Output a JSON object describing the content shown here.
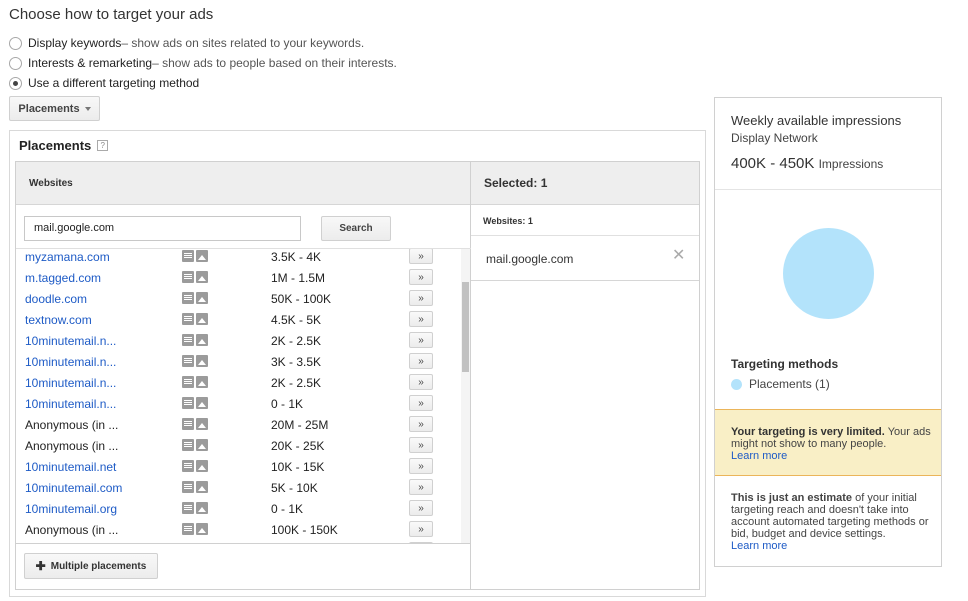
{
  "heading": "Choose how to target your ads",
  "options": [
    {
      "label": "Display keywords",
      "desc": " – show ads on sites related to your keywords.",
      "checked": false
    },
    {
      "label": "Interests & remarketing",
      "desc": " – show ads to people based on their interests.",
      "checked": false
    },
    {
      "label": "Use a different targeting method",
      "desc": "",
      "checked": true
    }
  ],
  "method_dropdown": {
    "label": "Placements",
    "icon": "chevron-down-icon"
  },
  "panel": {
    "title": "Placements",
    "help_glyph": "?",
    "websites_header": "Websites",
    "search_value": "mail.google.com",
    "search_button": "Search",
    "add_glyph": "»",
    "multiple_button": "Multiple placements",
    "multiple_plus": "✚",
    "rows": [
      {
        "site": "myzamana.com",
        "impressions": "3.5K - 4K",
        "link": true
      },
      {
        "site": "m.tagged.com",
        "impressions": "1M - 1.5M",
        "link": true
      },
      {
        "site": "doodle.com",
        "impressions": "50K - 100K",
        "link": true
      },
      {
        "site": "textnow.com",
        "impressions": "4.5K - 5K",
        "link": true
      },
      {
        "site": "10minutemail.n...",
        "impressions": "2K - 2.5K",
        "link": true
      },
      {
        "site": "10minutemail.n...",
        "impressions": "3K - 3.5K",
        "link": true
      },
      {
        "site": "10minutemail.n...",
        "impressions": "2K - 2.5K",
        "link": true
      },
      {
        "site": "10minutemail.n...",
        "impressions": "0 - 1K",
        "link": true
      },
      {
        "site": "Anonymous (in ...",
        "impressions": "20M - 25M",
        "link": false
      },
      {
        "site": "Anonymous (in ...",
        "impressions": "20K - 25K",
        "link": false
      },
      {
        "site": "10minutemail.net",
        "impressions": "10K - 15K",
        "link": true
      },
      {
        "site": "10minutemail.com",
        "impressions": "5K - 10K",
        "link": true
      },
      {
        "site": "10minutemail.org",
        "impressions": "0 - 1K",
        "link": true
      },
      {
        "site": "Anonymous (in ...",
        "impressions": "100K - 150K",
        "link": false
      },
      {
        "site": "",
        "impressions": "",
        "link": false
      }
    ],
    "selected_header": "Selected: 1",
    "selected_sub": "Websites: 1",
    "selected_items": [
      "mail.google.com"
    ],
    "remove_glyph": "✕"
  },
  "sidebar": {
    "title": "Weekly available impressions",
    "network": "Display Network",
    "range": "400K - 450K",
    "range_unit": "Impressions",
    "pie_color": "#b3e3fb",
    "targeting_title": "Targeting methods",
    "legend_label": "Placements (1)",
    "warning_bold": "Your targeting is very limited.",
    "warning_text": " Your ads might not show to many people.",
    "warning_link": "Learn more",
    "note_bold": "This is just an estimate",
    "note_text": " of your initial targeting reach and doesn't take into account automated targeting methods or bid, budget and device settings.",
    "note_link": "Learn more"
  },
  "colors": {
    "link": "#1e5bc6",
    "pie": "#b3e3fb",
    "warning_bg": "#f9efc6",
    "warning_border": "#ebb55a"
  }
}
